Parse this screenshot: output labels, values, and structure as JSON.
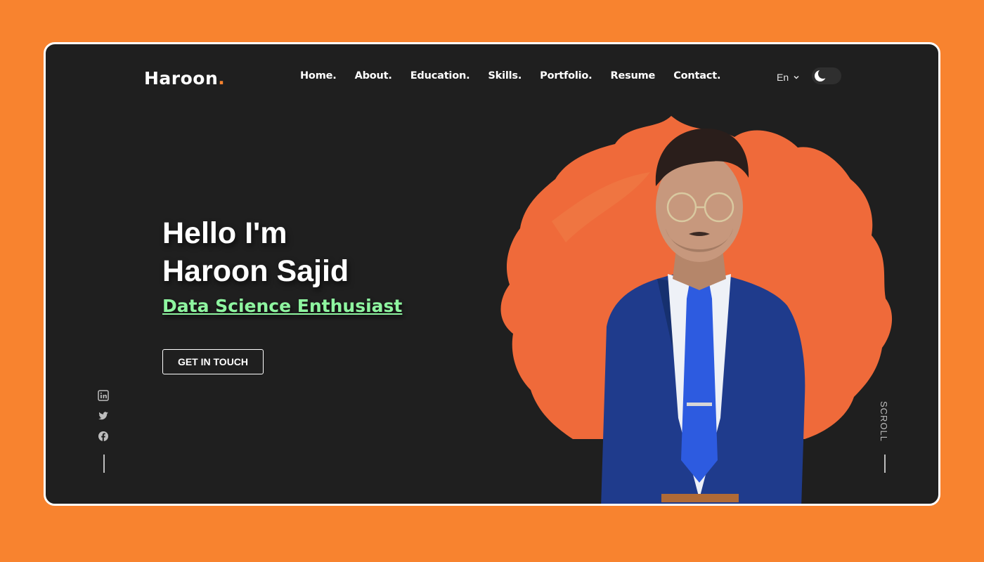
{
  "brand": {
    "name": "Haroon",
    "dot": ".",
    "accent": "#f8832f"
  },
  "nav": {
    "items": [
      {
        "label": "Home."
      },
      {
        "label": "About."
      },
      {
        "label": "Education."
      },
      {
        "label": "Skills."
      },
      {
        "label": "Portfolio."
      },
      {
        "label": "Resume"
      },
      {
        "label": "Contact."
      }
    ]
  },
  "header": {
    "language": "En",
    "language_icon": "chevron-down-icon",
    "theme_icon": "moon-icon"
  },
  "hero": {
    "greeting": "Hello I'm",
    "name": "Haroon Sajid",
    "subtitle": "Data Science Enthusiast",
    "subtitle_color": "#8ef5a0",
    "cta_label": "GET IN TOUCH"
  },
  "social": {
    "icons": [
      "linkedin-icon",
      "twitter-icon",
      "facebook-icon"
    ]
  },
  "scroll": {
    "label": "SCROLL"
  },
  "colors": {
    "background": "#f8832f",
    "panel": "#1f1f1f",
    "text": "#ffffff"
  }
}
